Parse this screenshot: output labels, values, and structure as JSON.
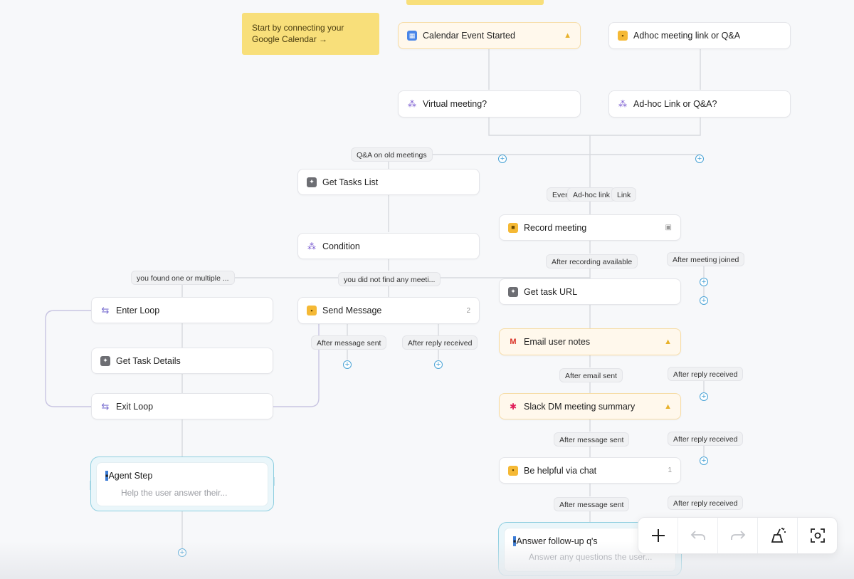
{
  "note": {
    "text": "Start by connecting your Google Calendar →"
  },
  "nodes": {
    "calendar_event": {
      "label": "Calendar Event Started"
    },
    "adhoc_link": {
      "label": "Adhoc meeting link or Q&A"
    },
    "virtual_meeting": {
      "label": "Virtual meeting?"
    },
    "adhoc_condition": {
      "label": "Ad-hoc Link or Q&A?"
    },
    "get_tasks_list": {
      "label": "Get Tasks List"
    },
    "condition": {
      "label": "Condition"
    },
    "record_meeting": {
      "label": "Record meeting"
    },
    "get_task_url": {
      "label": "Get task URL"
    },
    "enter_loop": {
      "label": "Enter Loop"
    },
    "send_message": {
      "label": "Send Message",
      "count": "2"
    },
    "get_task_details": {
      "label": "Get Task Details"
    },
    "exit_loop": {
      "label": "Exit Loop"
    },
    "email_user_notes": {
      "label": "Email user notes"
    },
    "slack_dm": {
      "label": "Slack DM meeting summary"
    },
    "be_helpful": {
      "label": "Be helpful via chat",
      "count": "1"
    },
    "agent_step": {
      "label": "Agent Step",
      "sub": "Help the user answer their..."
    },
    "answer_followup": {
      "label": "Answer follow-up q's",
      "sub": "Answer any questions the user..."
    }
  },
  "pills": {
    "qa_old": "Q&A on old meetings",
    "even": "Even",
    "adhoc_link": "Ad-hoc link",
    "link": "Link",
    "found": "you found one or multiple ...",
    "not_found": "you did not find any meeti...",
    "after_recording": "After recording available",
    "after_joined": "After meeting joined",
    "after_msg_sent_1": "After message sent",
    "after_reply_1": "After reply received",
    "after_email": "After email sent",
    "after_reply_2": "After reply received",
    "after_msg_sent_2": "After message sent",
    "after_reply_3": "After reply received",
    "after_msg_sent_3": "After message sent",
    "after_reply_4": "After reply received"
  },
  "toolbar": {
    "items": [
      "plus-icon",
      "undo-icon",
      "redo-icon",
      "clean-icon",
      "screenshot-icon"
    ]
  },
  "colors": {
    "warning": "#e8b22c",
    "accent": "#4aa3d6",
    "note": "#f8df7a",
    "agent_border": "#8fcfe0"
  }
}
